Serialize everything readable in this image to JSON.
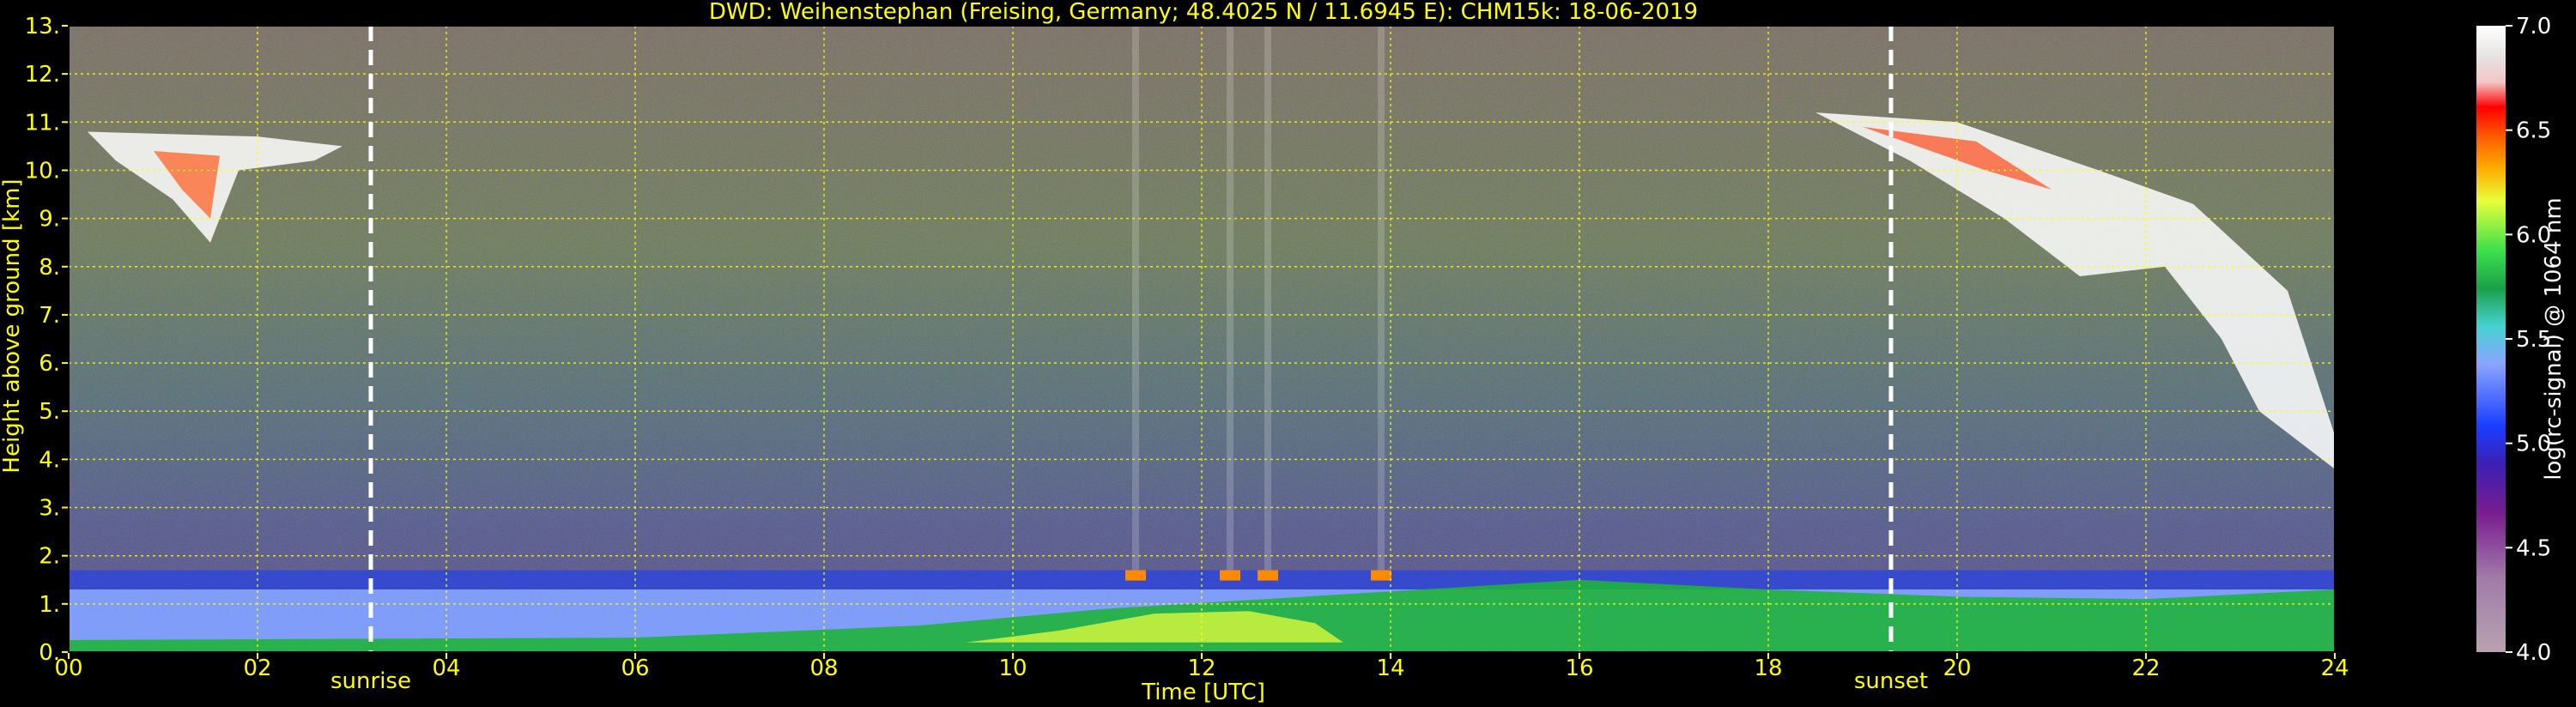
{
  "chart_data": {
    "type": "heatmap",
    "title": "DWD: Weihenstephan (Freising, Germany; 48.4025 N / 11.6945 E):    CHM15k: 18-06-2019",
    "xlabel": "Time [UTC]",
    "ylabel": "Height above ground [km]",
    "xlim": [
      0,
      24
    ],
    "ylim": [
      0,
      13
    ],
    "x_ticks": [
      "00",
      "02",
      "04",
      "06",
      "08",
      "10",
      "12",
      "14",
      "16",
      "18",
      "20",
      "22",
      "24"
    ],
    "y_ticks": [
      "0.",
      "1.",
      "2.",
      "3.",
      "4.",
      "5.",
      "6.",
      "7.",
      "8.",
      "9.",
      "10.",
      "11.",
      "12.",
      "13."
    ],
    "grid": true,
    "colorbar": {
      "label": "log(rc-signal) @ 1064 nm",
      "range": [
        4.0,
        7.0
      ],
      "ticks": [
        "4.0",
        "4.5",
        "5.0",
        "5.5",
        "6.0",
        "6.5",
        "7.0"
      ]
    },
    "markers": [
      {
        "label": "sunrise",
        "x": 3.2
      },
      {
        "label": "sunset",
        "x": 19.3
      }
    ],
    "features": {
      "boundary_layer_top_km": 1.3,
      "aerosol_layer_km": [
        0.2,
        1.7
      ],
      "cirrus_morning": {
        "x": [
          0.2,
          2.9
        ],
        "height_km": [
          8.5,
          10.8
        ]
      },
      "cirrus_evening": {
        "x": [
          18.5,
          24.0
        ],
        "height_km": [
          3.8,
          11.2
        ]
      },
      "convective_cloud_bases_km": 1.7
    }
  },
  "colors": {
    "axes_text": "#ffff00",
    "grid": "#ffff00",
    "markers": "#ffffff",
    "background": "#000000"
  }
}
